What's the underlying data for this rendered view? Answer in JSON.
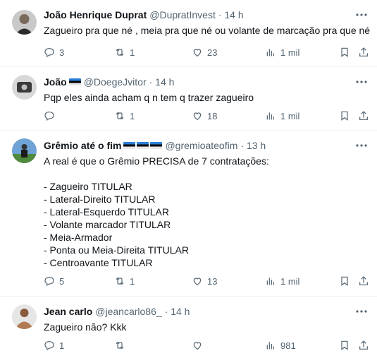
{
  "tweets": [
    {
      "name": "João Henrique Duprat",
      "flags": 0,
      "handle": "@DupratInvest",
      "time": "· 14 h",
      "text": "Zagueiro pra que né , meia pra que né ou volante de marcação pra que né",
      "replies": "3",
      "retweets": "1",
      "likes": "23",
      "views": "1 mil"
    },
    {
      "name": "João",
      "flags": 1,
      "handle": "@DoegeJvitor",
      "time": "· 14 h",
      "text": "Pqp eles ainda acham q n tem q trazer zagueiro",
      "replies": "",
      "retweets": "1",
      "likes": "18",
      "views": "1 mil"
    },
    {
      "name": "Grêmio até o fim",
      "flags": 3,
      "handle": "@gremioateofim",
      "time": "· 13 h",
      "text": "A real é que o Grêmio PRECISA de 7 contratações:\n\n- Zagueiro TITULAR\n- Lateral-Direito TITULAR\n- Lateral-Esquerdo TITULAR\n- Volante marcador TITULAR\n- Meia-Armador\n- Ponta ou Meia-Direita TITULAR\n- Centroavante TITULAR",
      "replies": "5",
      "retweets": "1",
      "likes": "13",
      "views": "1 mil"
    },
    {
      "name": "Jean carlo",
      "flags": 0,
      "handle": "@jeancarlo86_",
      "time": "· 14 h",
      "text": "Zagueiro não? Kkk",
      "replies": "1",
      "retweets": "",
      "likes": "",
      "views": "981"
    }
  ],
  "colors": {
    "text": "#0f1419",
    "muted": "#536471",
    "divider": "#eff3f4"
  },
  "icons": [
    "more-icon",
    "reply-icon",
    "retweet-icon",
    "like-icon",
    "views-icon",
    "bookmark-icon",
    "share-icon"
  ]
}
